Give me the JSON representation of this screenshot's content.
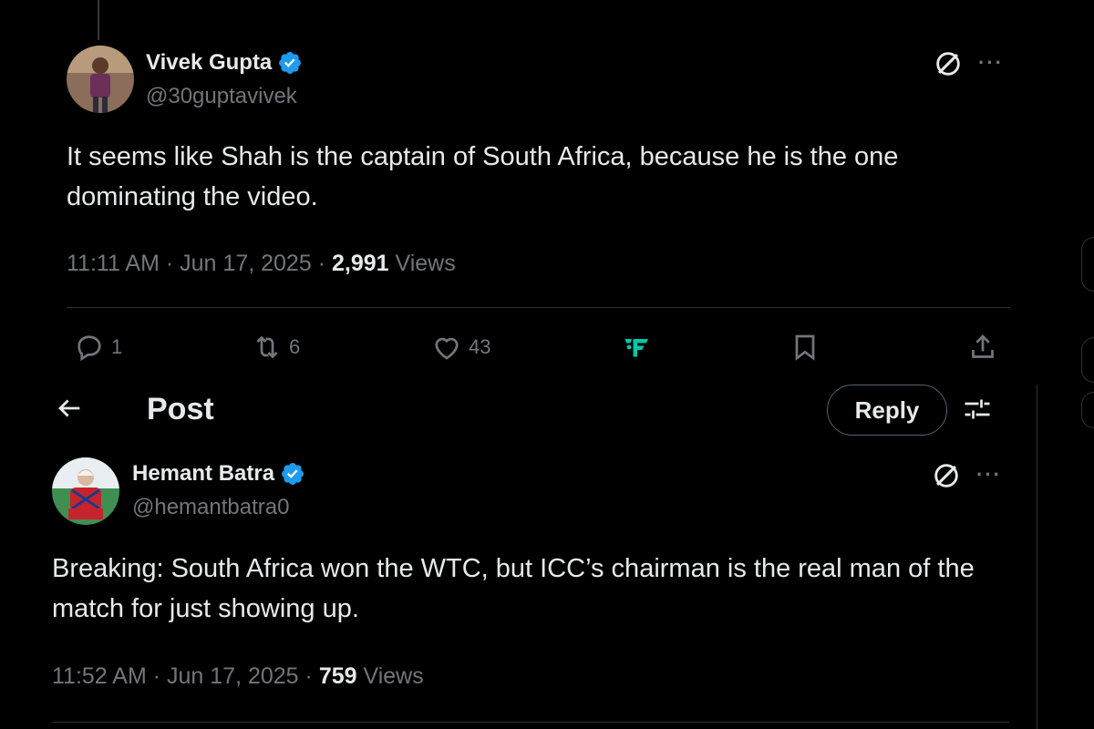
{
  "first_tweet": {
    "author_name": "Vivek Gupta",
    "handle": "@30guptavivek",
    "text": "It seems like Shah is the captain of South Africa, because he is the one dominating the video.",
    "time": "11:11 AM",
    "date": "Jun 17, 2025",
    "views_count": "2,991",
    "views_label": "Views",
    "actions": {
      "replies": "1",
      "reposts": "6",
      "likes": "43"
    }
  },
  "header": {
    "title": "Post",
    "reply_label": "Reply"
  },
  "second_tweet": {
    "author_name": "Hemant Batra",
    "handle": "@hemantbatra0",
    "text": "Breaking: South Africa won the WTC, but ICC’s chairman is the real man of the match for just showing up.",
    "time": "11:52 AM",
    "date": "Jun 17, 2025",
    "views_count": "759",
    "views_label": "Views"
  },
  "icons": {
    "verified": "verified-badge-icon",
    "grok": "grok-icon",
    "more": "more-icon",
    "reply": "reply-icon",
    "repost": "repost-icon",
    "like": "like-icon",
    "grok_tweet": "grok-analyze-icon",
    "bookmark": "bookmark-icon",
    "share": "share-icon",
    "back": "back-arrow-icon",
    "sliders": "sliders-icon"
  },
  "colors": {
    "background": "#000000",
    "text_primary": "#e7e9ea",
    "text_secondary": "#71767b",
    "verified_blue": "#1d9bf0",
    "accent_teal": "#00c8a8",
    "border": "#2f3336"
  }
}
